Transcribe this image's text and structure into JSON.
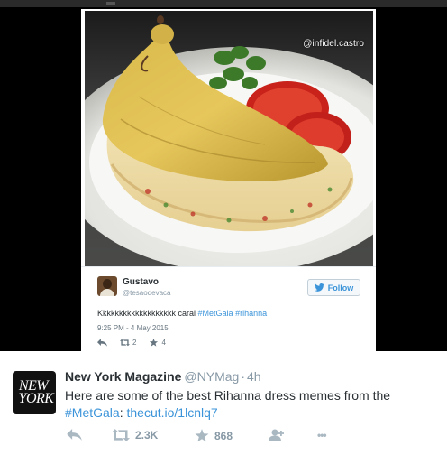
{
  "media": {
    "watermark": "@infidel.castro"
  },
  "embedded_tweet": {
    "name": "Gustavo",
    "handle": "@tesaodevaca",
    "follow_label": "Follow",
    "text_prefix": "Kkkkkkkkkkkkkkkkkkk carai ",
    "hashtag1": "#MetGala",
    "hashtag2": "#rihanna",
    "timestamp": "9:25 PM - 4 May 2015",
    "retweets": "2",
    "favorites": "4"
  },
  "tweet": {
    "name": "New York Magazine",
    "handle": "@NYMag",
    "dot": "·",
    "age": "4h",
    "avatar_logo_line1": "NEW",
    "avatar_logo_line2": "YORK",
    "text_line1": "Here are some of the best Rihanna dress memes from the",
    "hashtag": "#MetGala",
    "text_sep": ": ",
    "link": "thecut.io/1lcnlq7",
    "retweets": "2.3K",
    "favorites": "868",
    "more_label": "•••"
  },
  "colors": {
    "link": "#3b94d9",
    "muted": "#8899a6",
    "text": "#292f33",
    "frame": "#000000"
  },
  "icons": [
    "reply-icon",
    "retweet-icon",
    "favorite-icon",
    "follow-person-icon",
    "more-icon",
    "bird-icon"
  ]
}
